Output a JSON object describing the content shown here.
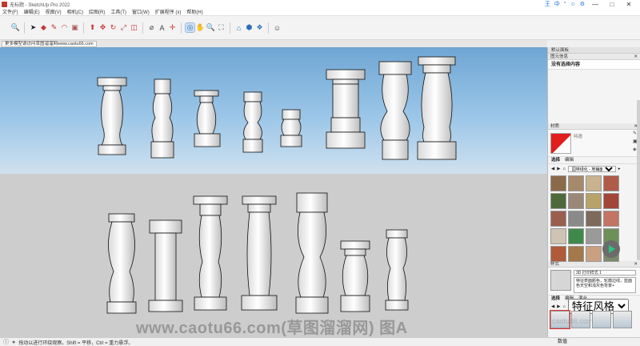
{
  "window": {
    "title": "无标题 - SketchUp Pro 2022",
    "right_icons": [
      "王",
      "中",
      "°",
      "☺",
      "⚙"
    ],
    "controls": [
      "—",
      "□",
      "✕"
    ]
  },
  "menu": [
    "文件(F)",
    "编辑(E)",
    "视图(V)",
    "相机(C)",
    "绘图(R)",
    "工具(T)",
    "窗口(W)",
    "扩展程序 (x)",
    "帮助(H)"
  ],
  "scene_tab": "更多模型请访问草图溜溜网www.caotu66.com",
  "tray": {
    "title": "默认面板",
    "entity_header": "图元信息",
    "entity_value": "没有选择内容",
    "materials_header": "材质",
    "material_name": "特邀",
    "material_tabs": [
      "选择",
      "编辑"
    ],
    "material_library": "园林绿化 - 地铺面和植被",
    "styles_header": "样式",
    "style_name": "3D 打印样式 1",
    "style_description": "特征表面颜色，轮廓边线，蓝面色天空和浅灰色背景+",
    "style_tabs": [
      "选择",
      "编辑",
      "混合"
    ],
    "style_library": "特征风格"
  },
  "status": {
    "text": "拖动以进行环绕观察。Shift = 平移，Ctrl = 重力悬浮。",
    "measurements_label": "数值"
  },
  "watermark": "www.caotu66.com(草图溜溜网) 图A",
  "watermark_small": "caotu66.com",
  "colors": {
    "accent": "#1e6fd9",
    "sky": "#8bbde3",
    "ground": "#cdcdcd",
    "material_swatch": "#e01e1e"
  },
  "toolbar_icons": [
    "search-icon",
    "select-icon",
    "eraser-icon",
    "pencil-icon",
    "arc-icon",
    "paint-icon",
    "push-pull-icon",
    "move-icon",
    "rotate-icon",
    "scale-icon",
    "offset-icon",
    "tape-icon",
    "text-icon",
    "axes-icon",
    "orbit-icon",
    "pan-icon",
    "zoom-icon",
    "zoom-extents-icon",
    "warehouse-icon",
    "extension-icon",
    "components-icon",
    "profile-icon"
  ]
}
